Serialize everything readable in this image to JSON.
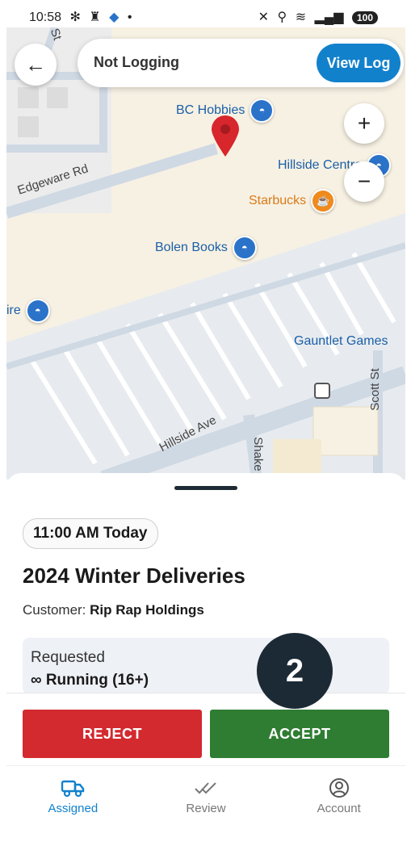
{
  "status_bar": {
    "time": "10:58",
    "left_icons": [
      "snowflake-icon",
      "tower-icon",
      "diamond-icon",
      "dot-icon"
    ],
    "right_icons": [
      "mute-icon",
      "location-icon",
      "wifi-icon",
      "signal-icon"
    ],
    "battery": "100"
  },
  "top_bar": {
    "log_status": "Not Logging",
    "view_log_label": "View Log"
  },
  "map": {
    "zoom_in": "+",
    "zoom_out": "−",
    "pois": [
      "BC Hobbies",
      "Hillside Centre",
      "Starbucks",
      "Bolen Books",
      "Gauntlet Games",
      "ire"
    ],
    "streets": [
      "Edgeware Rd",
      "Hillside Ave",
      "Scott St",
      "Shake",
      "St"
    ]
  },
  "sheet": {
    "time_chip": "11:00 AM Today",
    "title": "2024 Winter Deliveries",
    "customer_label": "Customer:",
    "customer_name": "Rip Rap Holdings",
    "requested_label": "Requested",
    "requested_value": "∞ Running (16+)"
  },
  "actions": {
    "reject_label": "REJECT",
    "accept_label": "ACCEPT"
  },
  "step_badge": "2",
  "bottom_nav": {
    "items": [
      {
        "label": "Assigned",
        "icon": "truck-icon",
        "active": true
      },
      {
        "label": "Review",
        "icon": "double-check-icon",
        "active": false
      },
      {
        "label": "Account",
        "icon": "account-icon",
        "active": false
      }
    ]
  },
  "colors": {
    "primary": "#1281cc",
    "reject": "#d32a2f",
    "accept": "#2e7d32",
    "badge": "#1c2a35",
    "map_bg": "#f7f1e3"
  }
}
